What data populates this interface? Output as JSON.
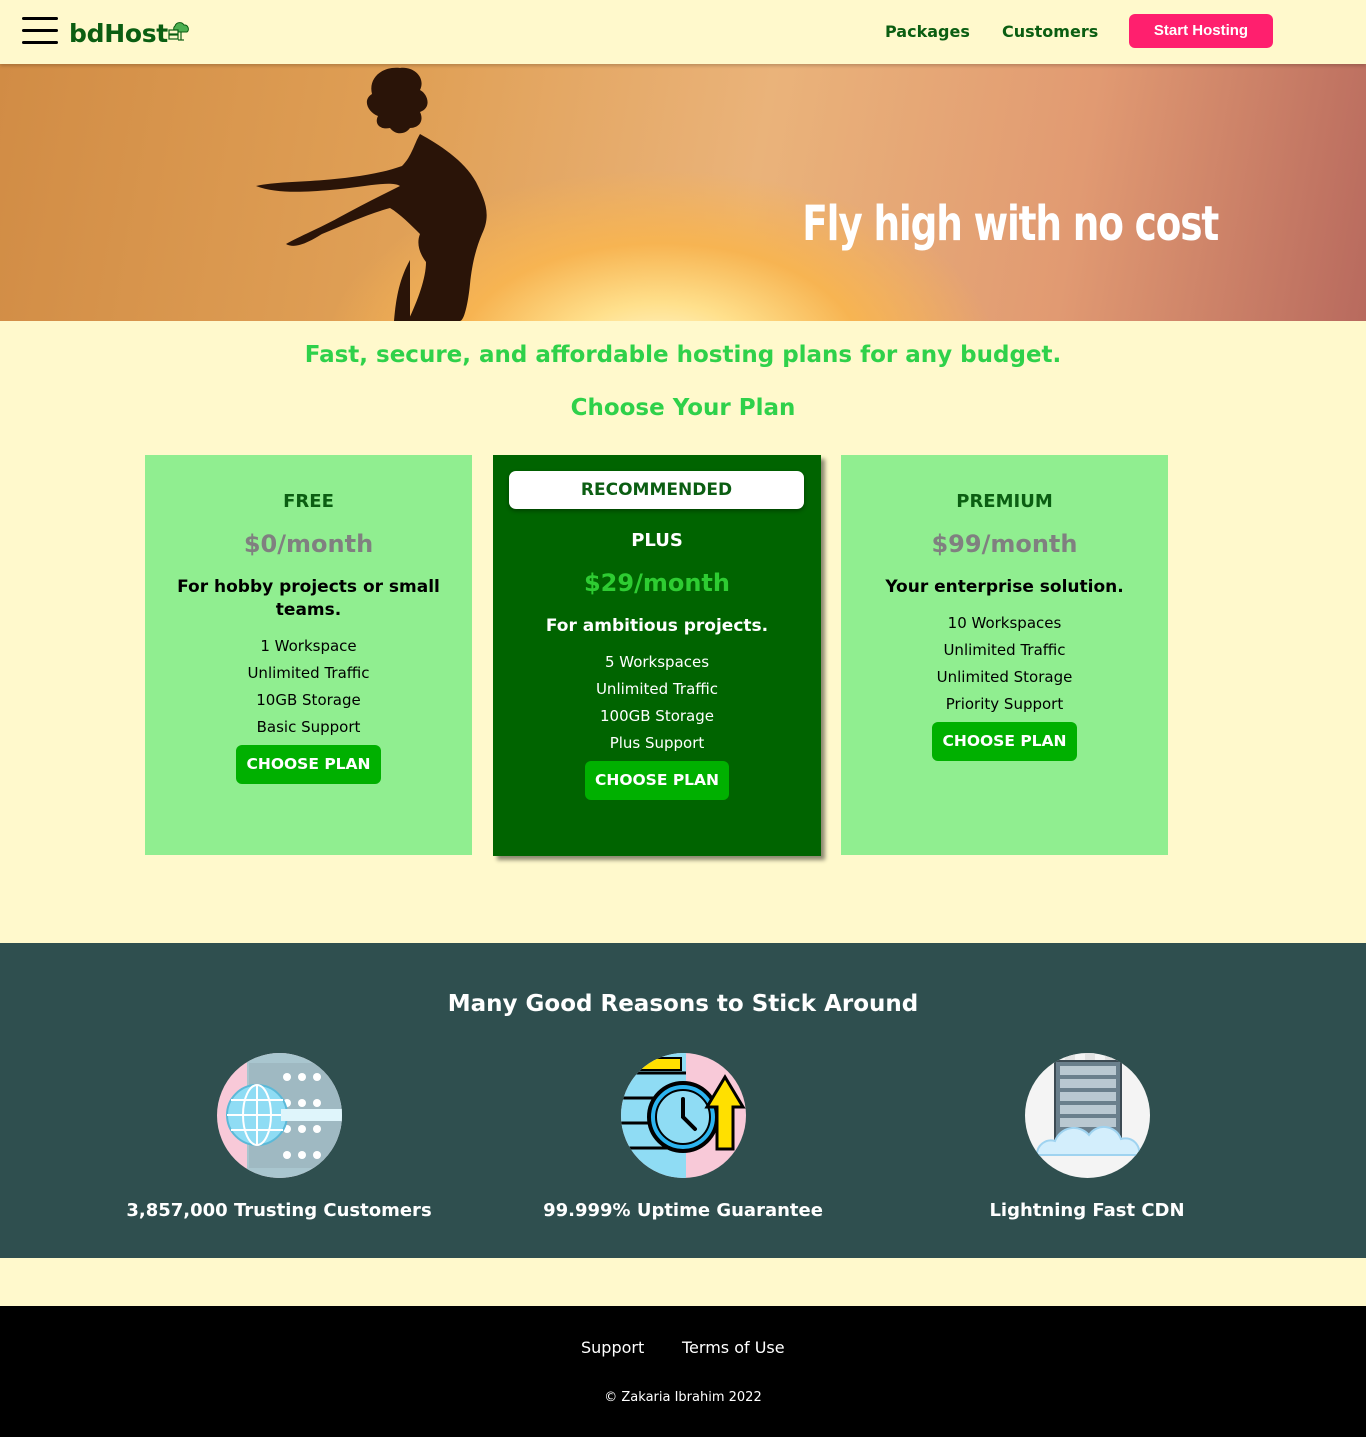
{
  "nav": {
    "brand": "bdHost",
    "links": [
      "Packages",
      "Customers"
    ],
    "cta": "Start Hosting"
  },
  "hero": {
    "headline": "Fly high with no cost"
  },
  "intro": {
    "tagline": "Fast, secure, and affordable hosting plans for any budget.",
    "section_title": "Choose Your Plan"
  },
  "plans": [
    {
      "name": "FREE",
      "price": "$0/month",
      "description": "For hobby projects or small teams.",
      "features": [
        "1 Workspace",
        "Unlimited Traffic",
        "10GB Storage",
        "Basic Support"
      ],
      "button": "CHOOSE PLAN"
    },
    {
      "badge": "RECOMMENDED",
      "name": "PLUS",
      "price": "$29/month",
      "description": "For ambitious projects.",
      "features": [
        "5 Workspaces",
        "Unlimited Traffic",
        "100GB Storage",
        "Plus Support"
      ],
      "button": "CHOOSE PLAN"
    },
    {
      "name": "PREMIUM",
      "price": "$99/month",
      "description": "Your enterprise solution.",
      "features": [
        "10 Workspaces",
        "Unlimited Traffic",
        "Unlimited Storage",
        "Priority Support"
      ],
      "button": "CHOOSE PLAN"
    }
  ],
  "reasons": {
    "title": "Many Good Reasons to Stick Around",
    "items": [
      {
        "icon": "globe-server-icon",
        "caption": "3,857,000 Trusting Customers"
      },
      {
        "icon": "clock-uptime-icon",
        "caption": "99.999% Uptime Guarantee"
      },
      {
        "icon": "cloud-server-icon",
        "caption": "Lightning Fast CDN"
      }
    ]
  },
  "footer": {
    "links": [
      "Support",
      "Terms of Use"
    ],
    "copyright": "© Zakaria Ibrahim 2022"
  },
  "colors": {
    "page_bg": "#fff9cc",
    "brand_green": "#0b5e12",
    "accent_pink": "#ff1f6e",
    "light_card": "#90ee90",
    "dark_card": "#006400",
    "button_green": "#00b000",
    "reasons_bg": "#2f4f4f",
    "tagline_green": "#2fd14a"
  }
}
